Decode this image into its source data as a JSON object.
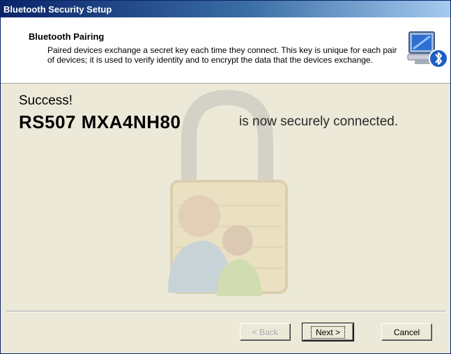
{
  "window": {
    "title": "Bluetooth Security Setup"
  },
  "header": {
    "title": "Bluetooth Pairing",
    "description": "Paired devices exchange a secret key each time they connect. This key is unique for each pair of devices; it is used to verify identity and to encrypt the data that the devices exchange.",
    "icon": "bluetooth-computer-icon"
  },
  "content": {
    "success_label": "Success!",
    "device_name": "RS507 MXA4NH80",
    "connected_text": "is now securely connected.",
    "watermark_icon": "padlock-users-icon"
  },
  "buttons": {
    "back": "< Back",
    "next": "Next >",
    "cancel": "Cancel"
  },
  "colors": {
    "title_bar": "#0A246A",
    "dialog_bg": "#ECE9D8",
    "header_bg": "#FFFFFF"
  }
}
